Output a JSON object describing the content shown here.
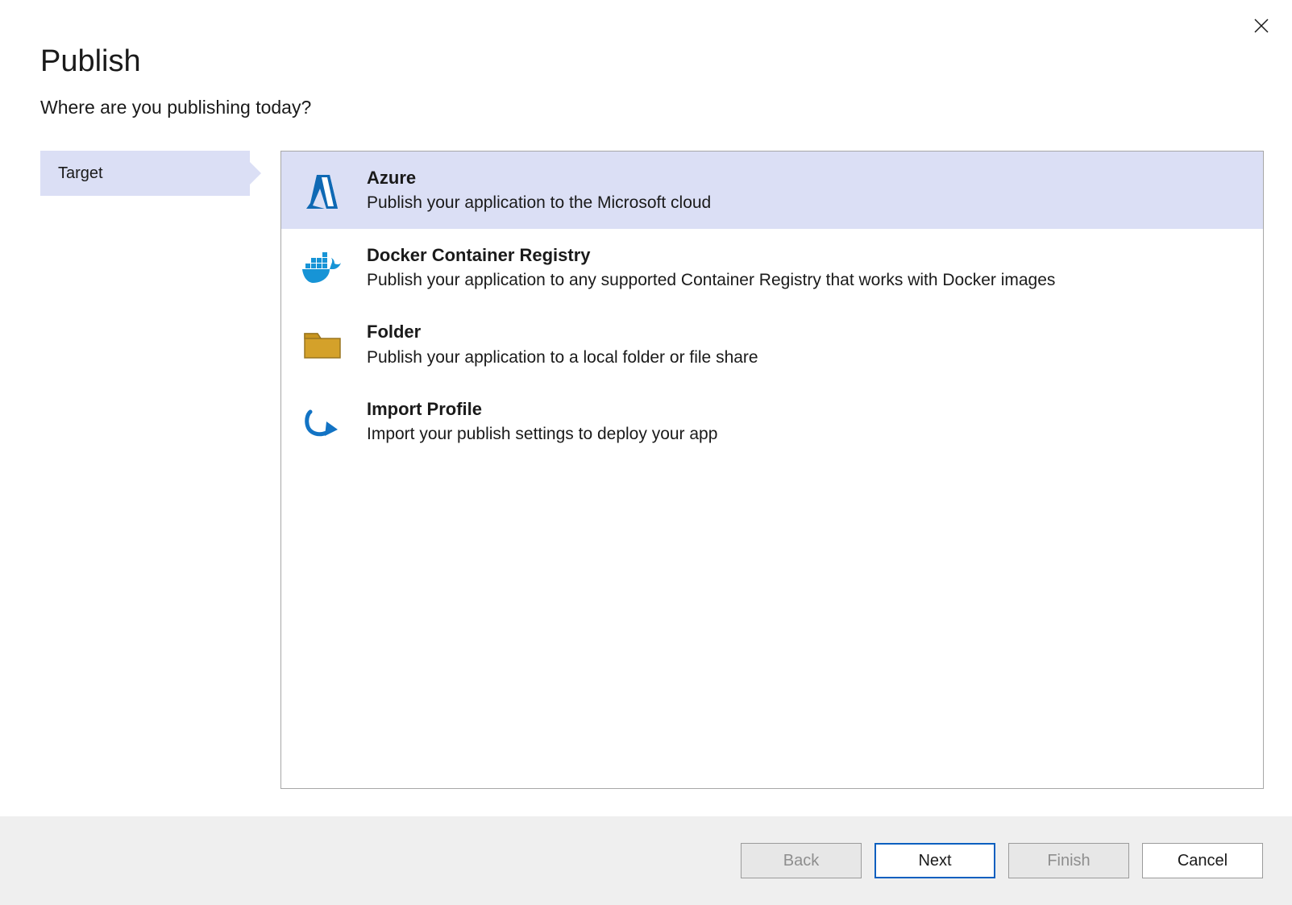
{
  "window": {
    "title": "Publish",
    "subtitle": "Where are you publishing today?"
  },
  "steps": {
    "target_label": "Target"
  },
  "options": {
    "azure": {
      "title": "Azure",
      "desc": "Publish your application to the Microsoft cloud"
    },
    "docker": {
      "title": "Docker Container Registry",
      "desc": "Publish your application to any supported Container Registry that works with Docker images"
    },
    "folder": {
      "title": "Folder",
      "desc": "Publish your application to a local folder or file share"
    },
    "import": {
      "title": "Import Profile",
      "desc": "Import your publish settings to deploy your app"
    }
  },
  "buttons": {
    "back": "Back",
    "next": "Next",
    "finish": "Finish",
    "cancel": "Cancel"
  },
  "colors": {
    "selection": "#dbdff5",
    "azure_blue": "#0f69b4",
    "docker_blue": "#1794d6",
    "folder_fill": "#d4a12a",
    "folder_stroke": "#9a7620",
    "primary_border": "#0a5fbf"
  }
}
